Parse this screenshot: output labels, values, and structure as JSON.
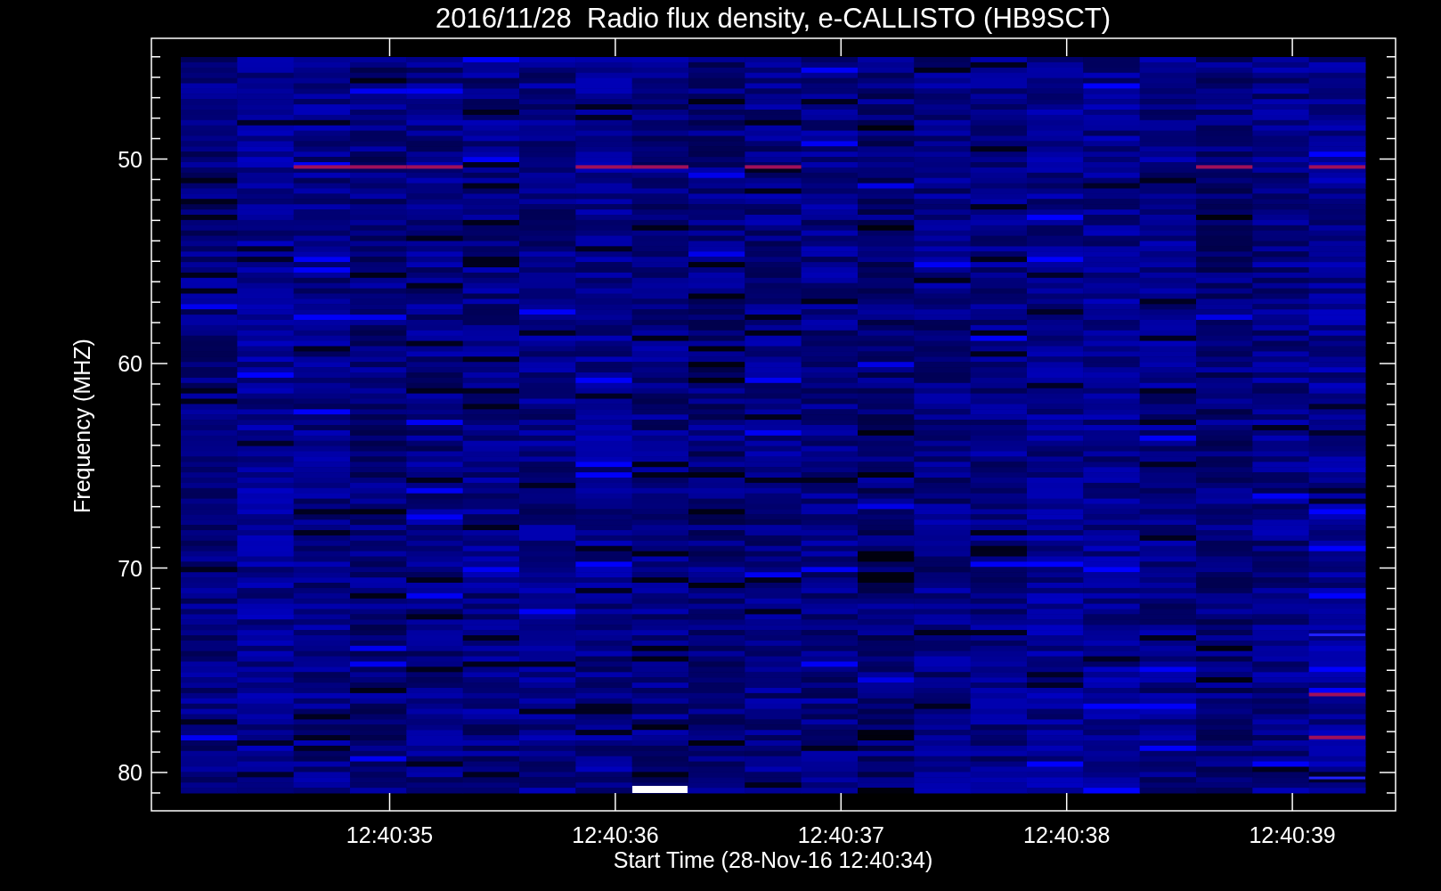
{
  "title": "2016/11/28  Radio flux density, e-CALLISTO (HB9SCT)",
  "y_axis": {
    "label": "Frequency (MHZ)",
    "ticks": [
      "50",
      "60",
      "70",
      "80"
    ]
  },
  "x_axis": {
    "label": "Start Time (28-Nov-16 12:40:34)",
    "ticks": [
      "12:40:35",
      "12:40:36",
      "12:40:37",
      "12:40:38",
      "12:40:39"
    ]
  }
}
